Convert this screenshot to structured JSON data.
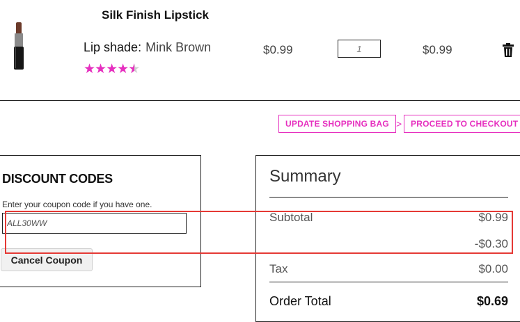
{
  "product": {
    "name": "Silk Finish Lipstick",
    "shade_label": "Lip shade:",
    "shade_value": "Mink Brown",
    "rating": 4.5,
    "rating_max": 5,
    "price": "$0.99",
    "quantity": "1",
    "row_total": "$0.99"
  },
  "actions": {
    "update_label": "UPDATE SHOPPING BAG",
    "checkout_label": "PROCEED TO CHECKOUT"
  },
  "discount": {
    "title": "DISCOUNT CODES",
    "help": "Enter your coupon code if you have one.",
    "code_value": "ALL30WW",
    "cancel_label": "Cancel Coupon"
  },
  "summary": {
    "title": "Summary",
    "subtotal_label": "Subtotal",
    "subtotal_value": "$0.99",
    "discount_value": "-$0.30",
    "tax_label": "Tax",
    "tax_value": "$0.00",
    "total_label": "Order Total",
    "total_value": "$0.69"
  },
  "colors": {
    "accent": "#e62fbf",
    "highlight": "#e53935"
  },
  "icons": {
    "delete": "trash-icon",
    "chevron": "chevron-right-icon"
  }
}
